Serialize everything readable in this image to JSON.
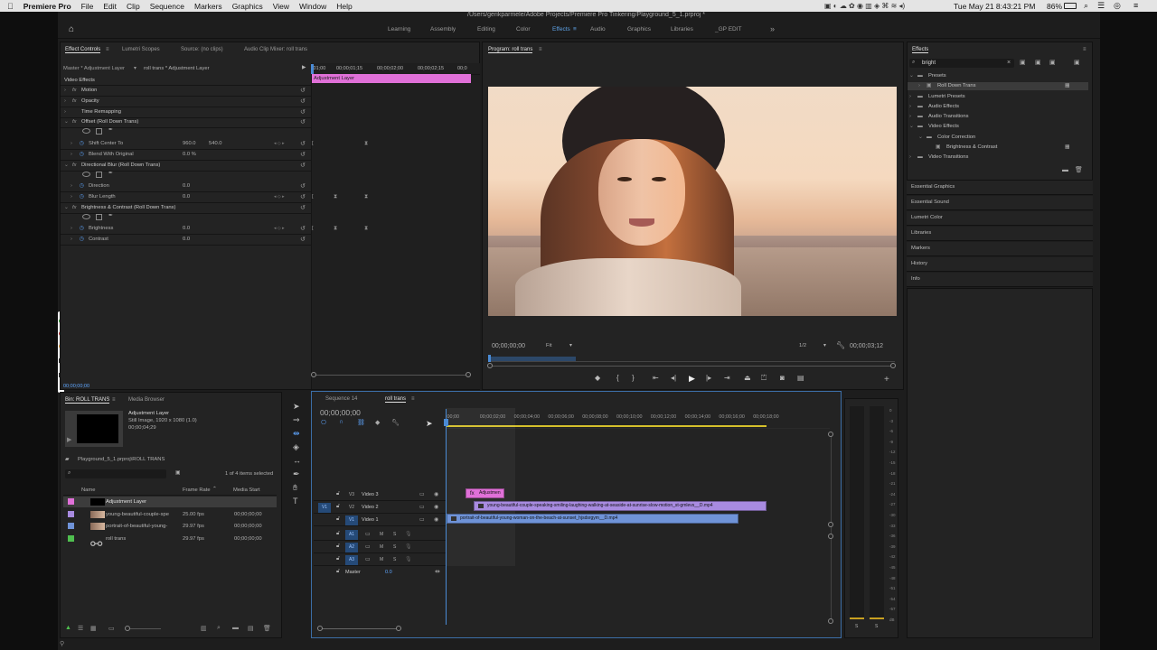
{
  "menubar": {
    "apple_icon": "apple-icon",
    "items": [
      "Premiere Pro",
      "File",
      "Edit",
      "Clip",
      "Sequence",
      "Markers",
      "Graphics",
      "View",
      "Window",
      "Help"
    ],
    "battery": "86%",
    "datetime": "Tue May 21  8:43:21 PM"
  },
  "window": {
    "path": "/Users/gerikparmele/Adobe Projects/Premiere Pro Tinkering/Playground_5_1.prproj *"
  },
  "workspaces": {
    "items": [
      "Learning",
      "Assembly",
      "Editing",
      "Color",
      "Effects",
      "Audio",
      "Graphics",
      "Libraries",
      "_GP EDIT"
    ],
    "active": "Effects",
    "more_icon": "chevrons-right-icon"
  },
  "effect_controls": {
    "tabs": [
      "Effect Controls",
      "Lumetri Scopes",
      "Source: (no clips)",
      "Audio Clip Mixer: roll trans"
    ],
    "master": "Master * Adjustment Layer",
    "clip": "roll trans * Adjustment Layer",
    "section": "Video Effects",
    "timecodes": [
      ";01;00",
      "00;00;01;15",
      "00;00;02;00",
      "00;00;02;15",
      "00;0"
    ],
    "clip_bar": "Adjustment Layer",
    "rows": [
      {
        "label": "Motion",
        "type": "effect"
      },
      {
        "label": "Opacity",
        "type": "effect"
      },
      {
        "label": "Time Remapping",
        "type": "effect"
      },
      {
        "label": "Offset (Roll Down Trans)",
        "type": "effect"
      },
      {
        "label": "Shift Center To",
        "v1": "960.0",
        "v2": "540.0"
      },
      {
        "label": "Blend With Original",
        "v1": "0.0 %"
      },
      {
        "label": "Directional Blur (Roll Down Trans)",
        "type": "effect"
      },
      {
        "label": "Direction",
        "v1": "0.0"
      },
      {
        "label": "Blur Length",
        "v1": "0.0"
      },
      {
        "label": "Brightness & Contrast (Roll Down Trans)",
        "type": "effect"
      },
      {
        "label": "Brightness",
        "v1": "0.0"
      },
      {
        "label": "Contrast",
        "v1": "0.0"
      }
    ],
    "footer_time": "00;00;00;00"
  },
  "program": {
    "title": "Program: roll trans",
    "timecode": "00;00;00;00",
    "fit": "Fit",
    "resolution": "1/2",
    "duration": "00;00;03;12"
  },
  "effects_panel": {
    "title": "Effects",
    "search": "bright",
    "tree": [
      {
        "label": "Presets",
        "level": 1,
        "open": true
      },
      {
        "label": "Roll Down Trans",
        "level": 2,
        "selected": true
      },
      {
        "label": "Lumetri Presets",
        "level": 1
      },
      {
        "label": "Audio Effects",
        "level": 1
      },
      {
        "label": "Audio Transitions",
        "level": 1
      },
      {
        "label": "Video Effects",
        "level": 1,
        "open": true
      },
      {
        "label": "Color Correction",
        "level": 2,
        "open": true
      },
      {
        "label": "Brightness & Contrast",
        "level": 3
      },
      {
        "label": "Video Transitions",
        "level": 1
      }
    ],
    "collapsed": [
      "Essential Graphics",
      "Essential Sound",
      "Lumetri Color",
      "Libraries",
      "Markers",
      "History",
      "Info"
    ]
  },
  "bin": {
    "tabs": [
      "Bin: ROLL TRANS",
      "Media Browser"
    ],
    "preview_name": "Adjustment Layer",
    "preview_meta1": "Still Image, 1920 x 1080 (1.0)",
    "preview_meta2": "00;00;04;29",
    "project": "Playground_5_1.prproj\\ROLL TRANS",
    "selected_count": "1 of 4 items selected",
    "columns": [
      "Name",
      "Frame Rate",
      "Media Start"
    ],
    "items": [
      {
        "name": "Adjustment Layer",
        "rate": "",
        "start": "",
        "color": "#e070d8"
      },
      {
        "name": "young-beautiful-couple-spe",
        "rate": "25.00 fps",
        "start": "00;00;00;00",
        "color": "#a88be0"
      },
      {
        "name": "portrait-of-beautiful-young-",
        "rate": "29.97 fps",
        "start": "00;00;00;00",
        "color": "#6f93d8"
      },
      {
        "name": "roll trans",
        "rate": "29.97 fps",
        "start": "00;00;00;00",
        "color": "#4fbf4f"
      }
    ]
  },
  "timeline": {
    "tabs": [
      "Sequence 14",
      "roll trans"
    ],
    "timecode": "00;00;00;00",
    "ruler": [
      ";00;00",
      "00;00;02;00",
      "00;00;04;00",
      "00;00;06;00",
      "00;00;08;00",
      "00;00;10;00",
      "00;00;12;00",
      "00;00;14;00",
      "00;00;16;00",
      "00;00;18;00"
    ],
    "video_tracks": [
      {
        "id": "V3",
        "name": "Video 3"
      },
      {
        "id": "V2",
        "name": "Video 2"
      },
      {
        "id": "V1",
        "name": "Video 1"
      }
    ],
    "source_patch": "V1",
    "audio_tracks": [
      "A1",
      "A2",
      "A3"
    ],
    "master": "Master",
    "master_value": "0.0",
    "clips": {
      "v3": "Adjustmen",
      "v2": "young-beautiful-couple-speaking-smiling-laughing-walking-at-seaside-at-sunrise-slow-motion_st-gmlevs__D.mp4",
      "v1": "portrait-of-beautiful-young-woman-on-the-beach-at-sunset_hjsdsrgym__D.mp4"
    }
  },
  "audio_meter": {
    "scale": [
      "0",
      "-3",
      "-6",
      "-9",
      "-12",
      "-15",
      "-18",
      "-21",
      "-24",
      "-27",
      "-30",
      "-33",
      "-36",
      "-39",
      "-42",
      "-45",
      "-48",
      "-51",
      "-54",
      "-57",
      "dB"
    ],
    "solo": [
      "S",
      "S"
    ]
  },
  "colors": {
    "accent": "#5fa6ff",
    "adjustment": "#e070d8",
    "clip_v2": "#a88be0",
    "clip_v1": "#6f93d8",
    "playhead": "#4a8ad4"
  }
}
